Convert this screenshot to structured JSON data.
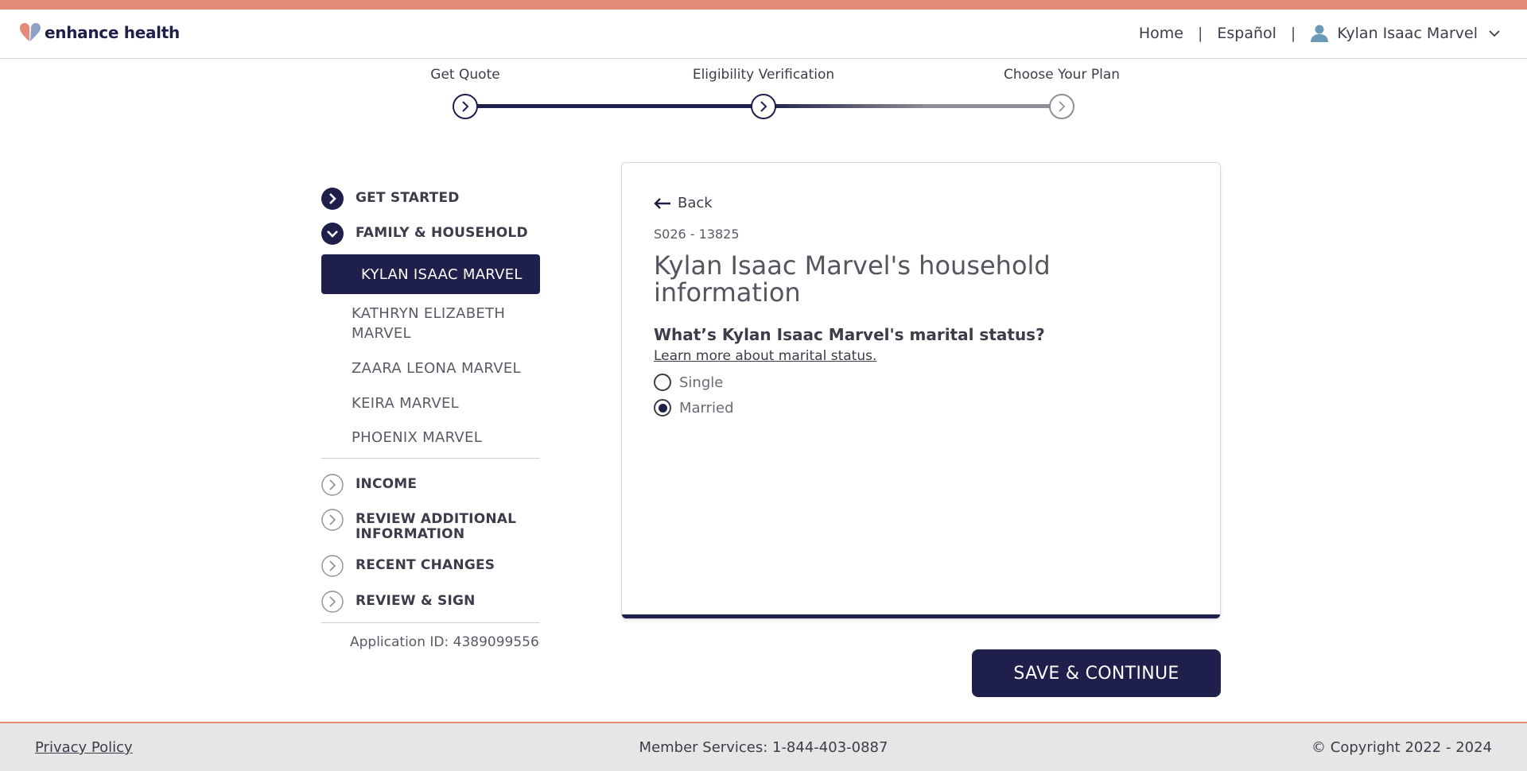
{
  "brand": {
    "name": "enhance health"
  },
  "nav": {
    "home": "Home",
    "language": "Español",
    "user": "Kylan Isaac Marvel",
    "separator": "|"
  },
  "stepper": {
    "steps": [
      "Get Quote",
      "Eligibility Verification",
      "Choose Your Plan"
    ]
  },
  "sidebar": {
    "sections": {
      "get_started": "GET STARTED",
      "family": "FAMILY & HOUSEHOLD",
      "income": "INCOME",
      "review_additional": "REVIEW ADDITIONAL INFORMATION",
      "recent_changes": "RECENT CHANGES",
      "review_sign": "REVIEW & SIGN"
    },
    "members": [
      "KYLAN ISAAC MARVEL",
      "KATHRYN ELIZABETH MARVEL",
      "ZAARA LEONA MARVEL",
      "KEIRA MARVEL",
      "PHOENIX MARVEL"
    ],
    "application_id": "Application ID: 4389099556"
  },
  "form": {
    "back": "Back",
    "code": "S026 - 13825",
    "title": "Kylan Isaac Marvel's household information",
    "question": "What’s Kylan Isaac Marvel's marital status?",
    "learn_more": "Learn more about marital status.",
    "options": [
      "Single",
      "Married"
    ],
    "selected": "Married"
  },
  "actions": {
    "save": "SAVE & CONTINUE"
  },
  "footer": {
    "privacy": "Privacy Policy",
    "member_services": "Member Services: 1-844-403-0887",
    "copyright": "© Copyright 2022 - 2024"
  },
  "colors": {
    "navy": "#1e1f4a",
    "coral": "#e38b78",
    "gray_line": "#8e8e96"
  }
}
